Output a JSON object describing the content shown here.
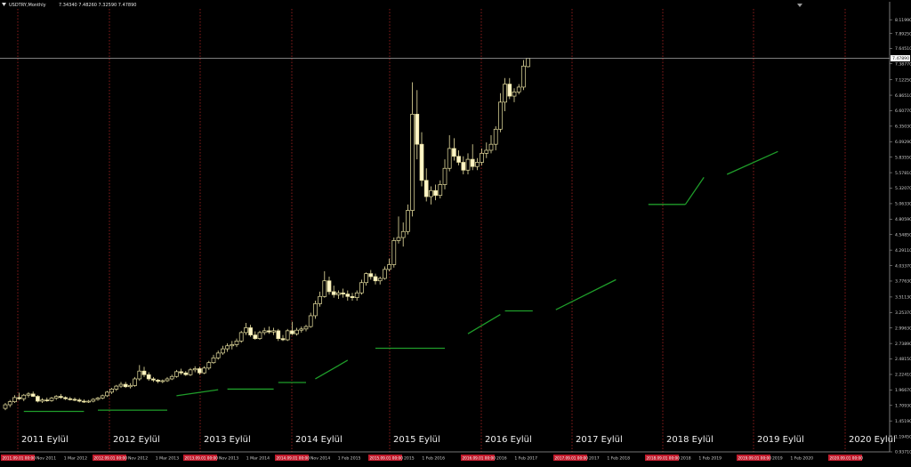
{
  "header": {
    "symbol": "USDTRY,Monthly",
    "ohlc": "7.34340 7.48260 7.32590 7.47890"
  },
  "chart_data": {
    "type": "candlestick",
    "title": "",
    "timeframe": "Monthly",
    "ylim": [
      0.9371,
      8.3
    ],
    "y_ticks": [
      "8.11990",
      "7.89250",
      "7.64510",
      "7.38770",
      "7.12250",
      "6.86510",
      "6.60770",
      "6.35030",
      "6.09290",
      "5.83550",
      "5.57810",
      "5.32070",
      "5.06330",
      "4.80590",
      "4.54850",
      "4.29110",
      "4.03370",
      "3.77630",
      "3.51130",
      "3.25370",
      "2.99630",
      "2.73890",
      "2.48150",
      "2.22410",
      "1.96670",
      "1.70930",
      "1.45190",
      "1.19450",
      "0.93710"
    ],
    "current_price": "7.47890",
    "current_price_value": 7.4789,
    "grid": false,
    "period_separators": [
      "2011 Eylül",
      "2012 Eylül",
      "2013 Eylül",
      "2014 Eylül",
      "2015 Eylül",
      "2016 Eylül",
      "2017 Eylül",
      "2018 Eylül",
      "2019 Eylül",
      "2020 Eylül"
    ],
    "candles": [
      {
        "o": 1.66,
        "h": 1.75,
        "l": 1.63,
        "c": 1.72
      },
      {
        "o": 1.72,
        "h": 1.8,
        "l": 1.68,
        "c": 1.77
      },
      {
        "o": 1.77,
        "h": 1.88,
        "l": 1.75,
        "c": 1.84
      },
      {
        "o": 1.84,
        "h": 1.92,
        "l": 1.8,
        "c": 1.82
      },
      {
        "o": 1.82,
        "h": 1.9,
        "l": 1.78,
        "c": 1.88
      },
      {
        "o": 1.88,
        "h": 1.93,
        "l": 1.84,
        "c": 1.9
      },
      {
        "o": 1.9,
        "h": 1.94,
        "l": 1.85,
        "c": 1.86
      },
      {
        "o": 1.86,
        "h": 1.88,
        "l": 1.76,
        "c": 1.78
      },
      {
        "o": 1.78,
        "h": 1.83,
        "l": 1.75,
        "c": 1.8
      },
      {
        "o": 1.8,
        "h": 1.84,
        "l": 1.77,
        "c": 1.79
      },
      {
        "o": 1.79,
        "h": 1.85,
        "l": 1.77,
        "c": 1.83
      },
      {
        "o": 1.83,
        "h": 1.88,
        "l": 1.8,
        "c": 1.86
      },
      {
        "o": 1.86,
        "h": 1.9,
        "l": 1.82,
        "c": 1.84
      },
      {
        "o": 1.84,
        "h": 1.86,
        "l": 1.8,
        "c": 1.82
      },
      {
        "o": 1.82,
        "h": 1.85,
        "l": 1.79,
        "c": 1.81
      },
      {
        "o": 1.81,
        "h": 1.84,
        "l": 1.78,
        "c": 1.8
      },
      {
        "o": 1.8,
        "h": 1.83,
        "l": 1.76,
        "c": 1.78
      },
      {
        "o": 1.78,
        "h": 1.81,
        "l": 1.75,
        "c": 1.77
      },
      {
        "o": 1.77,
        "h": 1.8,
        "l": 1.75,
        "c": 1.78
      },
      {
        "o": 1.78,
        "h": 1.83,
        "l": 1.76,
        "c": 1.81
      },
      {
        "o": 1.81,
        "h": 1.85,
        "l": 1.79,
        "c": 1.83
      },
      {
        "o": 1.83,
        "h": 1.89,
        "l": 1.81,
        "c": 1.87
      },
      {
        "o": 1.87,
        "h": 1.95,
        "l": 1.85,
        "c": 1.93
      },
      {
        "o": 1.93,
        "h": 2.0,
        "l": 1.9,
        "c": 1.98
      },
      {
        "o": 1.98,
        "h": 2.05,
        "l": 1.95,
        "c": 2.03
      },
      {
        "o": 2.03,
        "h": 2.1,
        "l": 2.0,
        "c": 2.06
      },
      {
        "o": 2.06,
        "h": 2.1,
        "l": 2.0,
        "c": 2.02
      },
      {
        "o": 2.02,
        "h": 2.08,
        "l": 1.99,
        "c": 2.04
      },
      {
        "o": 2.04,
        "h": 2.18,
        "l": 2.02,
        "c": 2.15
      },
      {
        "o": 2.15,
        "h": 2.38,
        "l": 2.12,
        "c": 2.28
      },
      {
        "o": 2.28,
        "h": 2.35,
        "l": 2.18,
        "c": 2.22
      },
      {
        "o": 2.22,
        "h": 2.26,
        "l": 2.12,
        "c": 2.15
      },
      {
        "o": 2.15,
        "h": 2.18,
        "l": 2.1,
        "c": 2.13
      },
      {
        "o": 2.13,
        "h": 2.15,
        "l": 2.08,
        "c": 2.11
      },
      {
        "o": 2.11,
        "h": 2.14,
        "l": 2.08,
        "c": 2.12
      },
      {
        "o": 2.12,
        "h": 2.18,
        "l": 2.1,
        "c": 2.15
      },
      {
        "o": 2.15,
        "h": 2.22,
        "l": 2.13,
        "c": 2.19
      },
      {
        "o": 2.19,
        "h": 2.3,
        "l": 2.17,
        "c": 2.27
      },
      {
        "o": 2.27,
        "h": 2.32,
        "l": 2.22,
        "c": 2.25
      },
      {
        "o": 2.25,
        "h": 2.28,
        "l": 2.2,
        "c": 2.22
      },
      {
        "o": 2.22,
        "h": 2.33,
        "l": 2.2,
        "c": 2.3
      },
      {
        "o": 2.3,
        "h": 2.36,
        "l": 2.26,
        "c": 2.32
      },
      {
        "o": 2.32,
        "h": 2.35,
        "l": 2.22,
        "c": 2.25
      },
      {
        "o": 2.25,
        "h": 2.36,
        "l": 2.23,
        "c": 2.33
      },
      {
        "o": 2.33,
        "h": 2.45,
        "l": 2.3,
        "c": 2.42
      },
      {
        "o": 2.42,
        "h": 2.55,
        "l": 2.4,
        "c": 2.5
      },
      {
        "o": 2.5,
        "h": 2.62,
        "l": 2.47,
        "c": 2.58
      },
      {
        "o": 2.58,
        "h": 2.7,
        "l": 2.55,
        "c": 2.65
      },
      {
        "o": 2.65,
        "h": 2.74,
        "l": 2.6,
        "c": 2.7
      },
      {
        "o": 2.7,
        "h": 2.78,
        "l": 2.64,
        "c": 2.72
      },
      {
        "o": 2.72,
        "h": 2.82,
        "l": 2.68,
        "c": 2.78
      },
      {
        "o": 2.78,
        "h": 2.95,
        "l": 2.75,
        "c": 2.92
      },
      {
        "o": 2.92,
        "h": 3.08,
        "l": 2.88,
        "c": 3.0
      },
      {
        "o": 3.0,
        "h": 3.05,
        "l": 2.85,
        "c": 2.88
      },
      {
        "o": 2.88,
        "h": 2.94,
        "l": 2.8,
        "c": 2.82
      },
      {
        "o": 2.82,
        "h": 2.95,
        "l": 2.8,
        "c": 2.92
      },
      {
        "o": 2.92,
        "h": 3.0,
        "l": 2.88,
        "c": 2.95
      },
      {
        "o": 2.95,
        "h": 3.02,
        "l": 2.9,
        "c": 2.93
      },
      {
        "o": 2.93,
        "h": 3.0,
        "l": 2.88,
        "c": 2.95
      },
      {
        "o": 2.95,
        "h": 2.98,
        "l": 2.78,
        "c": 2.82
      },
      {
        "o": 2.82,
        "h": 2.88,
        "l": 2.78,
        "c": 2.8
      },
      {
        "o": 2.8,
        "h": 2.98,
        "l": 2.78,
        "c": 2.95
      },
      {
        "o": 2.95,
        "h": 3.1,
        "l": 2.88,
        "c": 2.9
      },
      {
        "o": 2.9,
        "h": 3.0,
        "l": 2.87,
        "c": 2.96
      },
      {
        "o": 2.96,
        "h": 3.02,
        "l": 2.92,
        "c": 2.98
      },
      {
        "o": 2.98,
        "h": 3.05,
        "l": 2.94,
        "c": 3.02
      },
      {
        "o": 3.02,
        "h": 3.25,
        "l": 3.0,
        "c": 3.2
      },
      {
        "o": 3.2,
        "h": 3.45,
        "l": 3.15,
        "c": 3.4
      },
      {
        "o": 3.4,
        "h": 3.6,
        "l": 3.35,
        "c": 3.52
      },
      {
        "o": 3.52,
        "h": 3.94,
        "l": 3.5,
        "c": 3.78
      },
      {
        "o": 3.78,
        "h": 3.85,
        "l": 3.55,
        "c": 3.6
      },
      {
        "o": 3.6,
        "h": 3.7,
        "l": 3.5,
        "c": 3.55
      },
      {
        "o": 3.55,
        "h": 3.62,
        "l": 3.48,
        "c": 3.58
      },
      {
        "o": 3.58,
        "h": 3.65,
        "l": 3.5,
        "c": 3.56
      },
      {
        "o": 3.56,
        "h": 3.62,
        "l": 3.45,
        "c": 3.52
      },
      {
        "o": 3.52,
        "h": 3.58,
        "l": 3.45,
        "c": 3.5
      },
      {
        "o": 3.5,
        "h": 3.62,
        "l": 3.45,
        "c": 3.58
      },
      {
        "o": 3.58,
        "h": 3.8,
        "l": 3.55,
        "c": 3.75
      },
      {
        "o": 3.75,
        "h": 3.92,
        "l": 3.7,
        "c": 3.9
      },
      {
        "o": 3.9,
        "h": 3.96,
        "l": 3.8,
        "c": 3.85
      },
      {
        "o": 3.85,
        "h": 3.9,
        "l": 3.72,
        "c": 3.78
      },
      {
        "o": 3.78,
        "h": 3.85,
        "l": 3.72,
        "c": 3.82
      },
      {
        "o": 3.82,
        "h": 4.02,
        "l": 3.8,
        "c": 3.97
      },
      {
        "o": 3.97,
        "h": 4.15,
        "l": 3.94,
        "c": 4.05
      },
      {
        "o": 4.05,
        "h": 4.5,
        "l": 4.0,
        "c": 4.45
      },
      {
        "o": 4.45,
        "h": 4.85,
        "l": 4.4,
        "c": 4.5
      },
      {
        "o": 4.5,
        "h": 4.75,
        "l": 4.35,
        "c": 4.6
      },
      {
        "o": 4.6,
        "h": 5.05,
        "l": 4.55,
        "c": 4.95
      },
      {
        "o": 4.95,
        "h": 7.08,
        "l": 4.85,
        "c": 6.55
      },
      {
        "o": 6.55,
        "h": 6.95,
        "l": 5.8,
        "c": 6.05
      },
      {
        "o": 6.05,
        "h": 6.25,
        "l": 5.35,
        "c": 5.45
      },
      {
        "o": 5.45,
        "h": 5.65,
        "l": 5.1,
        "c": 5.18
      },
      {
        "o": 5.18,
        "h": 5.35,
        "l": 5.05,
        "c": 5.28
      },
      {
        "o": 5.28,
        "h": 5.38,
        "l": 5.12,
        "c": 5.2
      },
      {
        "o": 5.2,
        "h": 5.45,
        "l": 5.15,
        "c": 5.38
      },
      {
        "o": 5.38,
        "h": 5.8,
        "l": 5.3,
        "c": 5.65
      },
      {
        "o": 5.65,
        "h": 6.2,
        "l": 5.6,
        "c": 5.98
      },
      {
        "o": 5.98,
        "h": 6.15,
        "l": 5.78,
        "c": 5.85
      },
      {
        "o": 5.85,
        "h": 5.95,
        "l": 5.7,
        "c": 5.75
      },
      {
        "o": 5.75,
        "h": 5.85,
        "l": 5.55,
        "c": 5.62
      },
      {
        "o": 5.62,
        "h": 5.9,
        "l": 5.55,
        "c": 5.8
      },
      {
        "o": 5.8,
        "h": 6.05,
        "l": 5.62,
        "c": 5.68
      },
      {
        "o": 5.68,
        "h": 5.82,
        "l": 5.62,
        "c": 5.75
      },
      {
        "o": 5.75,
        "h": 5.98,
        "l": 5.7,
        "c": 5.9
      },
      {
        "o": 5.9,
        "h": 6.08,
        "l": 5.82,
        "c": 5.95
      },
      {
        "o": 5.95,
        "h": 6.2,
        "l": 5.9,
        "c": 6.05
      },
      {
        "o": 6.05,
        "h": 6.35,
        "l": 5.95,
        "c": 6.3
      },
      {
        "o": 6.3,
        "h": 6.9,
        "l": 6.25,
        "c": 6.75
      },
      {
        "o": 6.75,
        "h": 7.15,
        "l": 6.6,
        "c": 7.05
      },
      {
        "o": 7.05,
        "h": 7.15,
        "l": 6.8,
        "c": 6.85
      },
      {
        "o": 6.85,
        "h": 6.98,
        "l": 6.75,
        "c": 6.92
      },
      {
        "o": 6.92,
        "h": 7.05,
        "l": 6.88,
        "c": 7.0
      },
      {
        "o": 7.0,
        "h": 7.45,
        "l": 6.95,
        "c": 7.35
      },
      {
        "o": 7.34,
        "h": 7.48,
        "l": 7.33,
        "c": 7.48
      }
    ],
    "trendlines": [
      {
        "i1": 4,
        "v1": 1.61,
        "i2": 17,
        "v2": 1.61
      },
      {
        "i1": 20,
        "v1": 1.63,
        "i2": 35,
        "v2": 1.63
      },
      {
        "i1": 37,
        "v1": 1.87,
        "i2": 46,
        "v2": 1.97
      },
      {
        "i1": 48,
        "v1": 1.98,
        "i2": 58,
        "v2": 1.98
      },
      {
        "i1": 59,
        "v1": 2.09,
        "i2": 65,
        "v2": 2.09
      },
      {
        "i1": 67,
        "v1": 2.15,
        "i2": 74,
        "v2": 2.46
      },
      {
        "i1": 80,
        "v1": 2.66,
        "i2": 95,
        "v2": 2.66
      },
      {
        "i1": 100,
        "v1": 2.9,
        "i2": 107,
        "v2": 3.22
      },
      {
        "i1": 108,
        "v1": 3.28,
        "i2": 114,
        "v2": 3.28
      },
      {
        "i1": 119,
        "v1": 3.3,
        "i2": 132,
        "v2": 3.8
      },
      {
        "i1": 139,
        "v1": 5.05,
        "i2": 147,
        "v2": 5.05
      },
      {
        "i1": 147,
        "v1": 5.05,
        "i2": 151,
        "v2": 5.5
      },
      {
        "i1": 156,
        "v1": 5.55,
        "i2": 167,
        "v2": 5.93
      }
    ]
  },
  "x_axis_labels": [
    {
      "text": "2011.09.01 00:00",
      "hi": true
    },
    {
      "text": "Nov 2011",
      "hi": false
    },
    {
      "text": "1 Mar 2012",
      "hi": false
    },
    {
      "text": "2012.09.01 00:00",
      "hi": true
    },
    {
      "text": "Nov 2012",
      "hi": false
    },
    {
      "text": "1 Mar 2013",
      "hi": false
    },
    {
      "text": "2013.09.01 00:00",
      "hi": true
    },
    {
      "text": "Nov 2013",
      "hi": false
    },
    {
      "text": "1 Mar 2014",
      "hi": false
    },
    {
      "text": "2014.09.01 00:00",
      "hi": true
    },
    {
      "text": "Nov 2014",
      "hi": false
    },
    {
      "text": "1 Feb 2015",
      "hi": false
    },
    {
      "text": "2015.09.01 00:00",
      "hi": true
    },
    {
      "text": "2015",
      "hi": false
    },
    {
      "text": "1 Feb 2016",
      "hi": false
    },
    {
      "text": "2016.09.01 00:00",
      "hi": true
    },
    {
      "text": "2016",
      "hi": false
    },
    {
      "text": "1 Feb 2017",
      "hi": false
    },
    {
      "text": "2017.09.01 00:00",
      "hi": true
    },
    {
      "text": "2017",
      "hi": false
    },
    {
      "text": "1 Feb 2018",
      "hi": false
    },
    {
      "text": "2018.09.01 00:00",
      "hi": true
    },
    {
      "text": "2018",
      "hi": false
    },
    {
      "text": "1 Feb 2019",
      "hi": false
    },
    {
      "text": "2019.09.01 00:00",
      "hi": true
    },
    {
      "text": "2019",
      "hi": false
    },
    {
      "text": "1 Feb 2020",
      "hi": false
    },
    {
      "text": "2020.09.01 00:00",
      "hi": true
    }
  ],
  "colors": {
    "background": "#000000",
    "candle": "#e8e0a0",
    "bull_fill": "#000000",
    "bear_fill": "#fff6c8",
    "separator": "#c62828",
    "trendline": "#1f9d2a",
    "axis": "#9a9a9a",
    "price_line": "#a8a8a8",
    "highlight_label_bg": "#c0192a"
  }
}
